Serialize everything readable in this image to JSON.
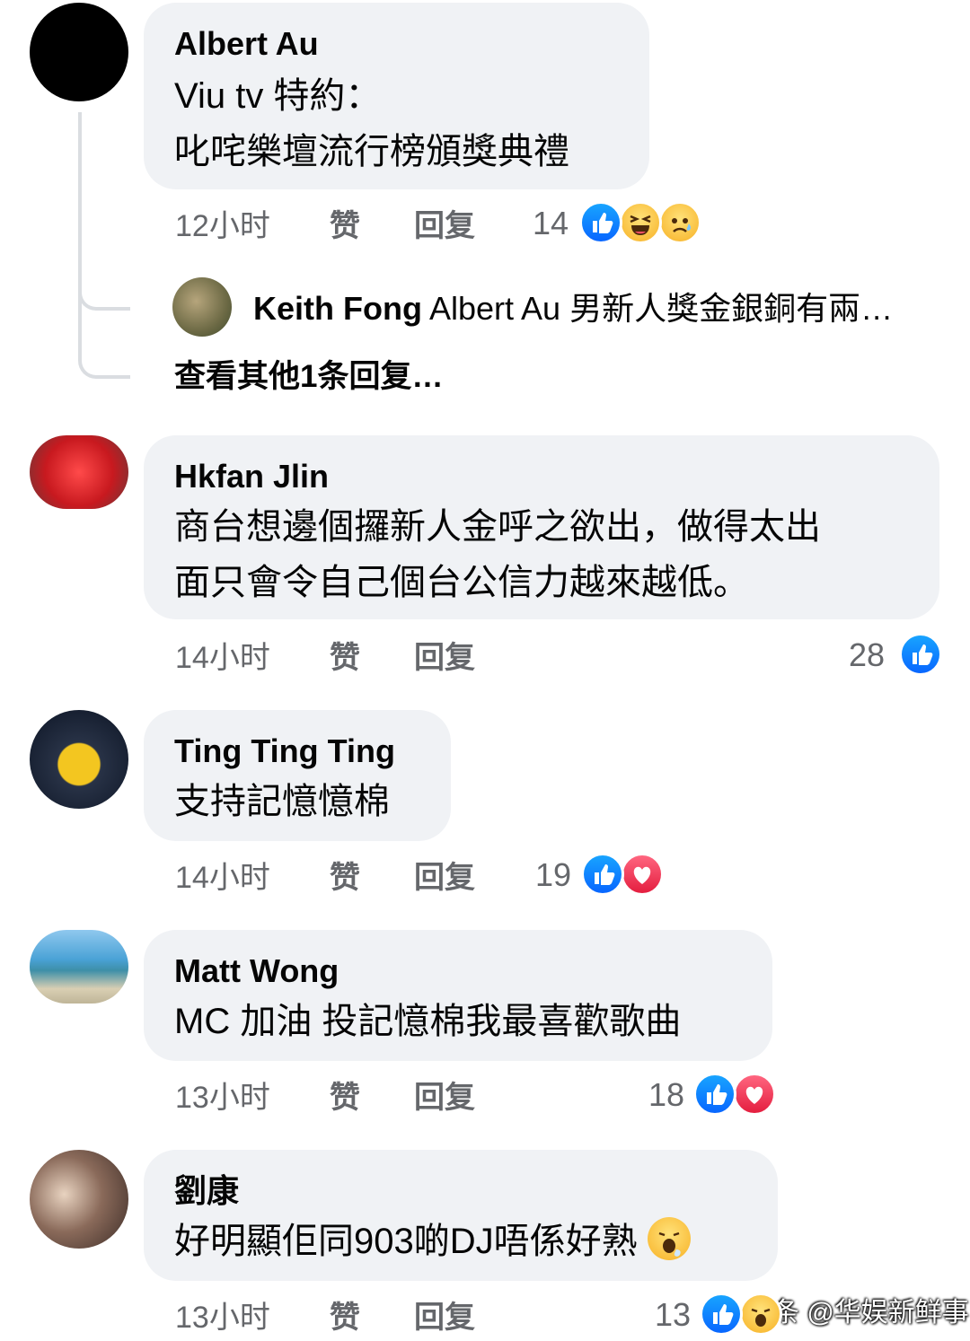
{
  "comments": [
    {
      "author": "Albert Au",
      "lines": [
        "Viu tv  特約：",
        "叱咤樂壇流行榜頒獎典禮"
      ],
      "time": "12小时",
      "like_label": "赞",
      "reply_label": "回复",
      "reaction_count": "14",
      "reactions": [
        "like-icon",
        "haha-icon",
        "sad-icon"
      ],
      "avatar_color": "#000000"
    },
    {
      "author": "Hkfan Jlin",
      "lines": [
        "商台想邊個攞新人金呼之欲出，做得太出",
        "面只會令自己個台公信力越來越低。"
      ],
      "time": "14小时",
      "like_label": "赞",
      "reply_label": "回复",
      "reaction_count": "28",
      "reactions": [
        "like-icon"
      ]
    },
    {
      "author": "Ting Ting Ting",
      "lines": [
        "支持記憶憶棉"
      ],
      "time": "14小时",
      "like_label": "赞",
      "reply_label": "回复",
      "reaction_count": "19",
      "reactions": [
        "like-icon",
        "heart-icon"
      ]
    },
    {
      "author": "Matt Wong",
      "lines": [
        "MC 加油 投記憶棉我最喜歡歌曲"
      ],
      "time": "13小时",
      "like_label": "赞",
      "reply_label": "回复",
      "reaction_count": "18",
      "reactions": [
        "like-icon",
        "heart-icon"
      ]
    },
    {
      "author": "劉康",
      "lines": [
        "好明顯佢同903啲DJ唔係好熟"
      ],
      "time": "13小时",
      "like_label": "赞",
      "reply_label": "回复",
      "reaction_count": "13",
      "reactions": [
        "like-icon",
        "yawn-icon"
      ]
    }
  ],
  "reply_preview": {
    "author": "Keith Fong",
    "text": "Albert Au 男新人獎金銀銅有兩…"
  },
  "view_more_replies": "查看其他1条回复…",
  "watermark": "头条 @华娱新鲜事",
  "colors": {
    "bubble": "#f0f2f5",
    "meta": "#65676b",
    "like": "#0866ff",
    "heart": "#e41e3f"
  }
}
